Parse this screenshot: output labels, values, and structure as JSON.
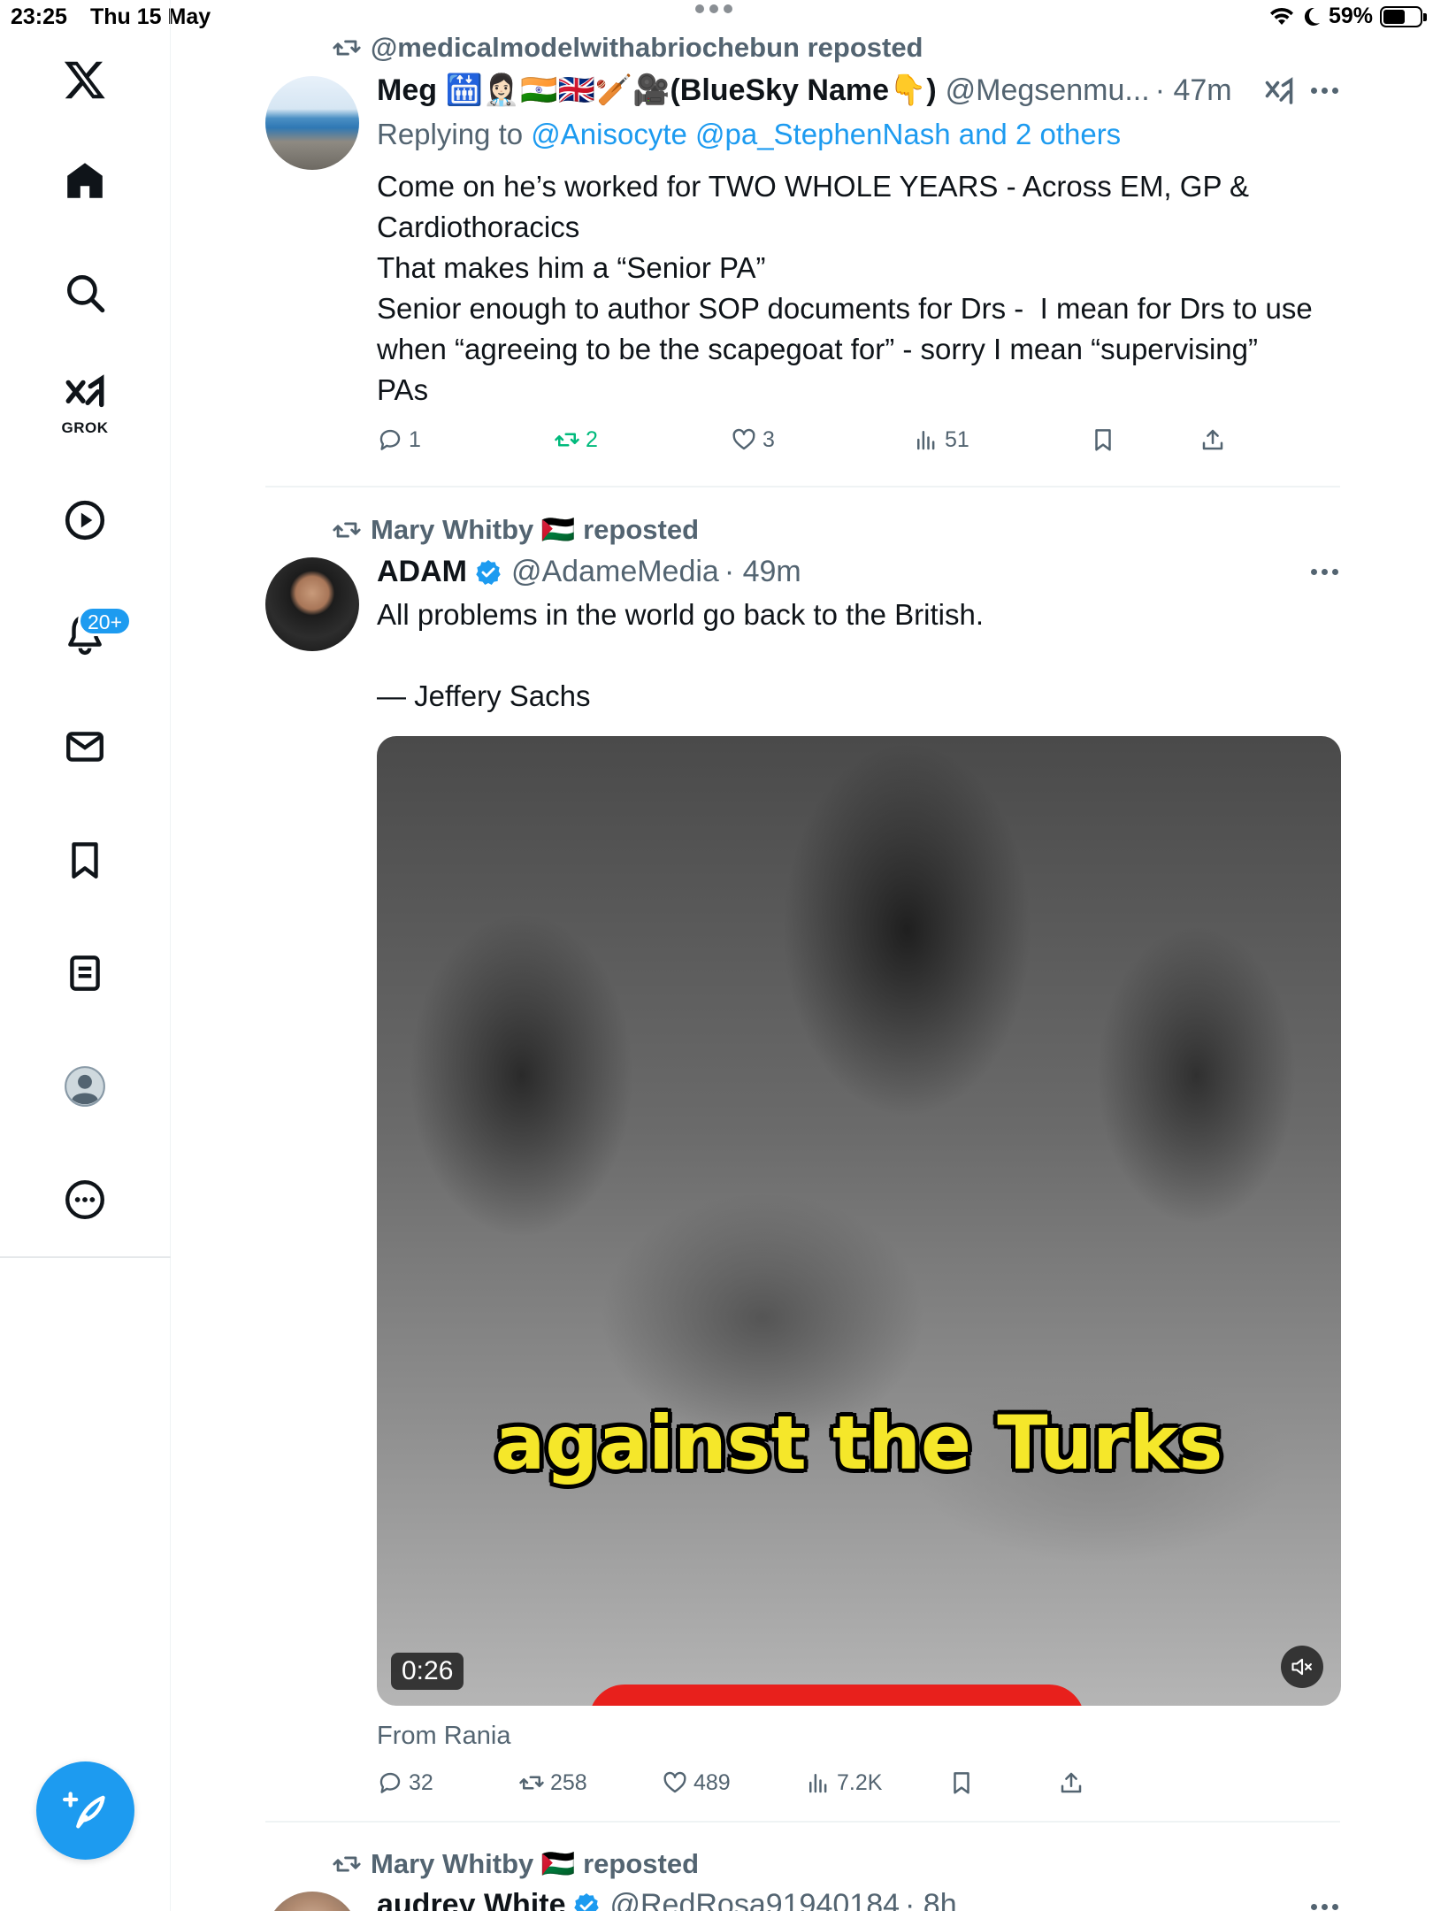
{
  "status_bar": {
    "time": "23:25",
    "date": "Thu 15 May",
    "battery": "59%",
    "battery_level": 0.59
  },
  "sidebar": {
    "items": [
      {
        "name": "X logo"
      },
      {
        "name": "Home"
      },
      {
        "name": "Explore"
      },
      {
        "name": "Grok",
        "label": "GROK"
      },
      {
        "name": "Video"
      },
      {
        "name": "Notifications",
        "badge": "20+"
      },
      {
        "name": "Messages"
      },
      {
        "name": "Bookmarks"
      },
      {
        "name": "Lists"
      },
      {
        "name": "Profile"
      },
      {
        "name": "More"
      }
    ],
    "compose": "Post"
  },
  "tweets": [
    {
      "repost_by": "@medicalmodelwithabriochebun reposted",
      "name": "Meg 🛗👩🏻‍⚕️🇮🇳🇬🇧🏏🎥(BlueSky Name👇)",
      "handle": "@Megsenmu...",
      "time": "· 47m",
      "reply_prefix": "Replying to ",
      "reply_to": "@Anisocyte @pa_StephenNash and 2 others",
      "text": "Come on he’s worked for TWO WHOLE YEARS - Across EM, GP &\nCardiothoracics\nThat makes him a “Senior PA”\nSenior enough to author SOP documents for Drs -  I mean for Drs to use\nwhen “agreeing to be the scapegoat for” - sorry I mean “supervising”\nPAs",
      "replies": "1",
      "reposts": "2",
      "likes": "3",
      "views": "51"
    },
    {
      "repost_by": "Mary Whitby 🇵🇸 reposted",
      "name": "ADAM",
      "verified": true,
      "handle": "@AdameMedia",
      "time": "· 49m",
      "text": "All problems in the world go back to the British.\n\n— Jeffery Sachs",
      "media": {
        "caption": "against the Turks",
        "duration": "0:26"
      },
      "from_label": "From Rania",
      "replies": "32",
      "reposts": "258",
      "likes": "489",
      "views": "7.2K"
    },
    {
      "repost_by": "Mary Whitby 🇵🇸 reposted",
      "name": "audrey White",
      "verified": true,
      "handle": "@RedRosa91940184",
      "time": "· 8h"
    }
  ],
  "colors": {
    "accent": "#1d9bf0",
    "text_secondary": "#536471",
    "repost_green": "#00ba7c"
  }
}
